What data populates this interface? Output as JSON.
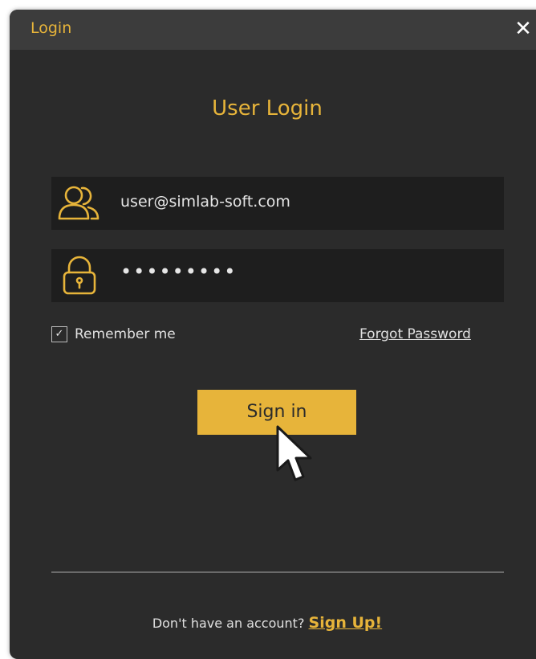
{
  "window": {
    "title": "Login",
    "close_label": "✕"
  },
  "form": {
    "heading": "User Login",
    "username": {
      "value": "user@simlab-soft.com",
      "icon": "users-icon"
    },
    "password": {
      "masked_value": "•••••••••",
      "icon": "lock-icon"
    },
    "remember": {
      "label": "Remember me",
      "checked": true,
      "check_glyph": "✓"
    },
    "forgot_label": "Forgot Password",
    "signin_label": "Sign in"
  },
  "footer": {
    "prompt": "Don't have an account?",
    "signup_label": "Sign Up!"
  },
  "colors": {
    "accent": "#e7b43a",
    "background": "#2b2b2b",
    "titlebar": "#3c3c3c",
    "field": "#1e1e1e",
    "text": "#e0e0e0"
  }
}
